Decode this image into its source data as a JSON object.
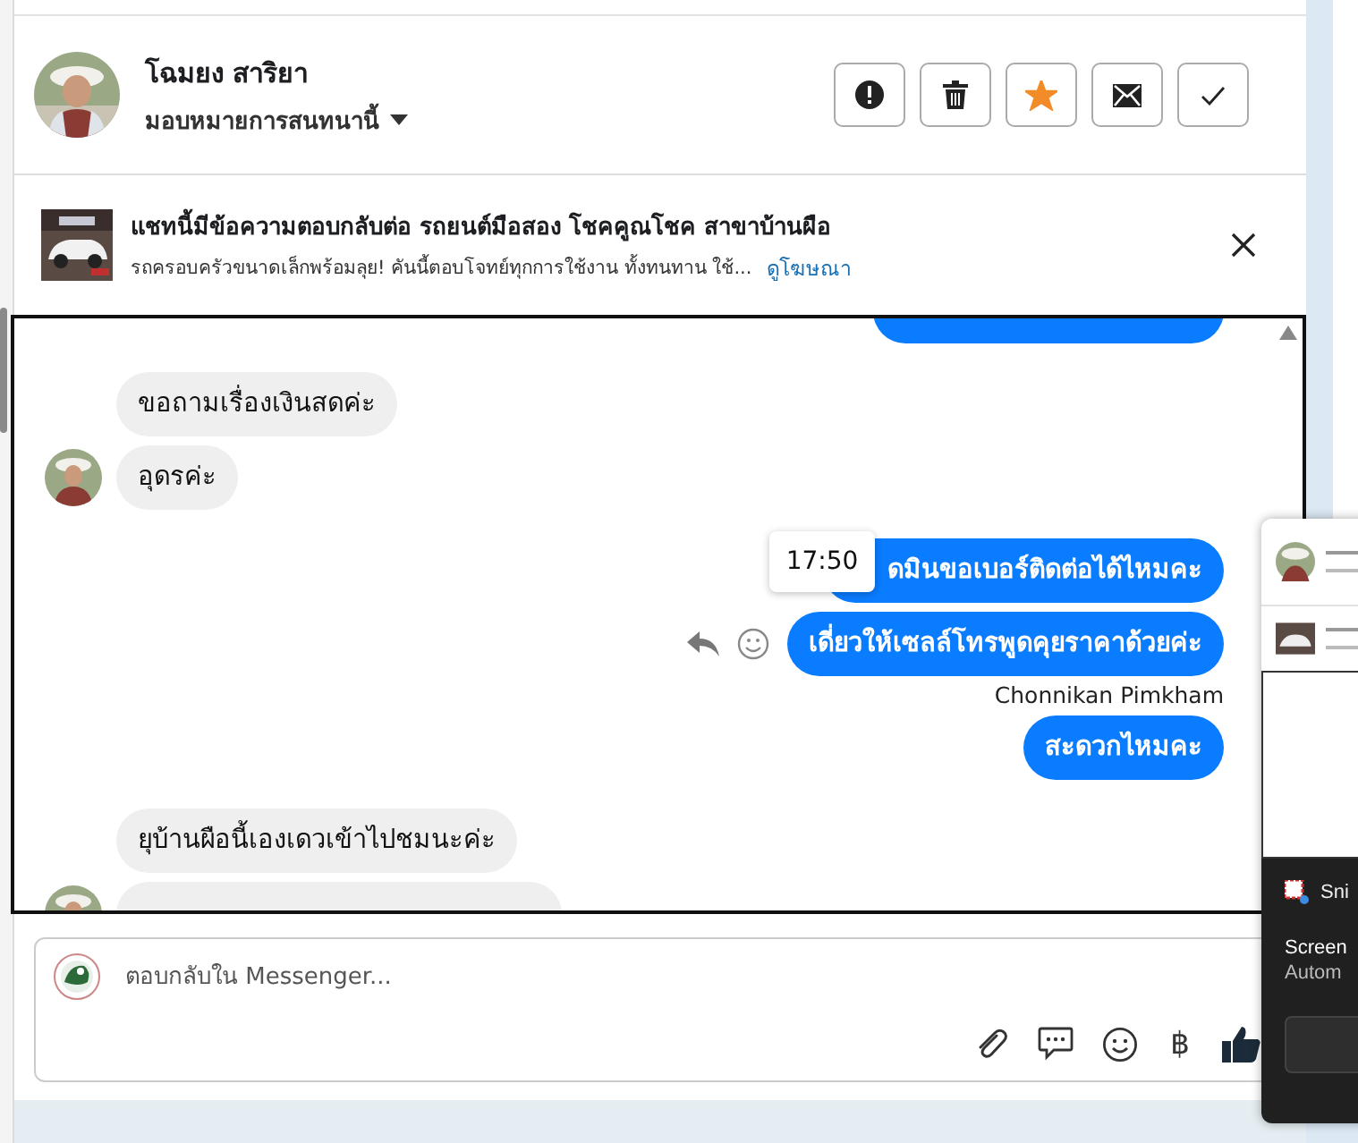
{
  "header": {
    "name": "โฉมยง สาริยา",
    "assign_label": "มอบหมายการสนทนานี้",
    "actions": [
      {
        "kind": "alert"
      },
      {
        "kind": "delete"
      },
      {
        "kind": "star",
        "on": true
      },
      {
        "kind": "mail"
      },
      {
        "kind": "done"
      }
    ]
  },
  "ad": {
    "title": "แชทนี้มีข้อความตอบกลับต่อ รถยนต์มือสอง โชคคูณโชค สาขาบ้านผือ",
    "description": "รถครอบครัวขนาดเล็กพร้อมลุย! คันนี้ตอบโจทย์ทุกการใช้งาน ทั้งทนทาน ใช้...",
    "link": "ดูโฆษณา"
  },
  "messages": [
    {
      "kind": "sent"
    },
    {
      "kind": "received",
      "text": "ขอถามเรื่องเงินสดค่ะ",
      "avatar": false
    },
    {
      "kind": "received",
      "text": "อุดรค่ะ",
      "avatar": true
    },
    {
      "kind": "sent",
      "text": "ดมินขอเบอร์ติดต่อได้ไหมคะ",
      "time": "17:50"
    },
    {
      "kind": "sent",
      "text": "เดี่ยวให้เซลล์โทรพูดคุยราคาด้วยค่ะ",
      "hover_actions": true,
      "sender": "Chonnikan Pimkham"
    },
    {
      "kind": "sent",
      "text": "สะดวกไหมคะ"
    },
    {
      "kind": "received",
      "text": "ยุบ้านผือนี้เองเดวเข้าไปชมนะค่ะ",
      "avatar": false
    },
    {
      "kind": "received",
      "avatar": true
    }
  ],
  "composer": {
    "placeholder": "ตอบกลับใน Messenger...",
    "tools": [
      {
        "kind": "attach"
      },
      {
        "kind": "saved-reply"
      },
      {
        "kind": "emoji"
      },
      {
        "kind": "currency",
        "symbol": "฿"
      },
      {
        "kind": "like"
      }
    ]
  },
  "notification": {
    "app": "Sni",
    "title": "Screen",
    "body": "Autom"
  }
}
